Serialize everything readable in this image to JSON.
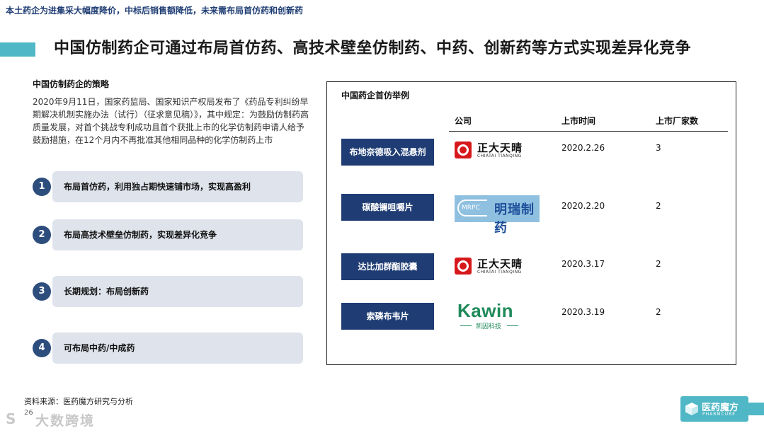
{
  "top_note": "本土药企为进集采大幅度降价，中标后销售额降低，未来需布局首仿药和创新药",
  "main_title": "中国仿制药企可通过布局首仿药、高技术壁垒仿制药、中药、创新药等方式实现差异化竞争",
  "strategy": {
    "title": "中国仿制药企的策略",
    "body": "2020年9月11日，国家药监局、国家知识产权局发布了《药品专利纠纷早期解决机制实施办法（试行）（征求意见稿）》，其中规定：为鼓励仿制药高质量发展，对首个挑战专利成功且首个获批上市的化学仿制药申请人给予鼓励措施，在12个月内不再批准其他相同品种的化学仿制药上市",
    "items": [
      {
        "num": "1",
        "text": "布局首仿药，利用独占期快速铺市场，实现高盈利"
      },
      {
        "num": "2",
        "text": "布局高技术壁垒仿制药，实现差异化竞争"
      },
      {
        "num": "3",
        "text": "长期规划：布局创新药"
      },
      {
        "num": "4",
        "text": "可布局中药/中成药"
      }
    ]
  },
  "table": {
    "title": "中国药企首仿举例",
    "headers": {
      "company": "公司",
      "date": "上市时间",
      "count": "上市厂家数"
    },
    "rows": [
      {
        "drug": "布地奈德吸入混悬剂",
        "company_logo": "正大天晴",
        "company_logo_sub": "CHIATAI TIANQING",
        "date": "2020.2.26",
        "count": "3"
      },
      {
        "drug": "碳酸镧咀嚼片",
        "company_logo": "明瑞制药",
        "company_logo_sub": "MRPC",
        "date": "2020.2.20",
        "count": "2"
      },
      {
        "drug": "达比加群酯胶囊",
        "company_logo": "正大天晴",
        "company_logo_sub": "CHIATAI TIANQING",
        "date": "2020.3.17",
        "count": "2"
      },
      {
        "drug": "索磷布韦片",
        "company_logo": "Kawin",
        "company_logo_sub": "凯因科技",
        "date": "2020.3.19",
        "count": "2"
      }
    ]
  },
  "source": "资料来源：医药魔方研究与分析",
  "page_number": "26",
  "watermark": "大数跨境",
  "brand": {
    "name": "医药魔方",
    "sub": "PHARMCUBE"
  },
  "colors": {
    "navy": "#1f3d74",
    "teal": "#4fb7c5",
    "item_bg": "#dfe3ec",
    "logo_red": "#d7191c",
    "kawin_green": "#1f8a5a"
  }
}
